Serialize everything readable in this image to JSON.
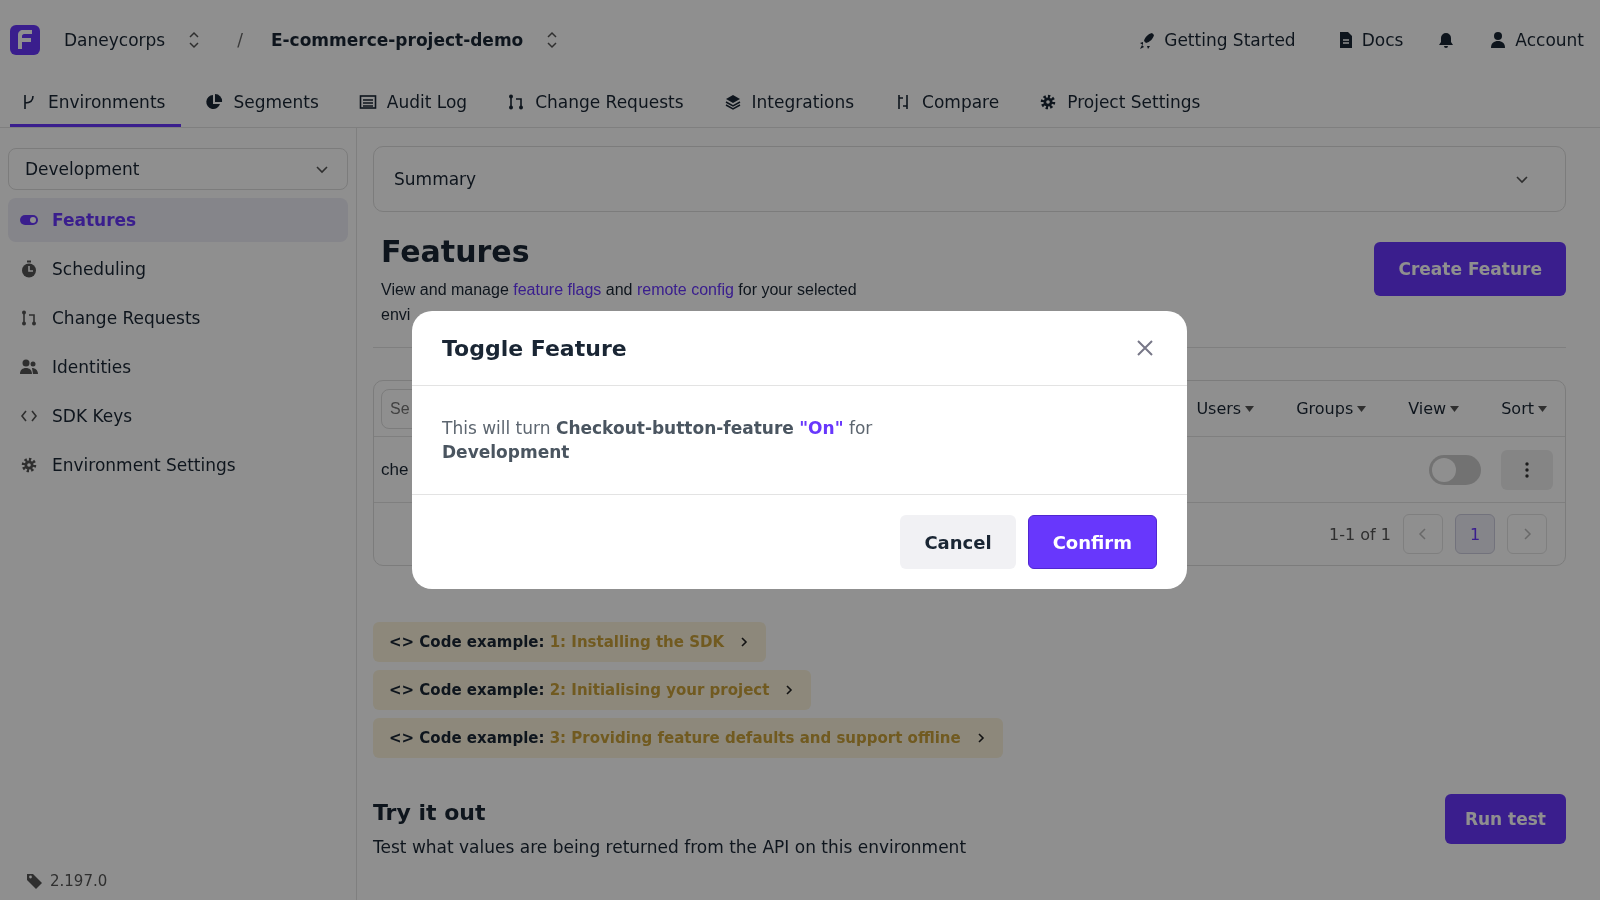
{
  "topbar": {
    "organisation": "Daneycorps",
    "separator": "/",
    "project": "E-commerce-project-demo",
    "links": [
      "Getting Started",
      "Docs",
      "Account"
    ]
  },
  "tabs": [
    {
      "label": "Environments",
      "selected": true
    },
    {
      "label": "Segments",
      "selected": false
    },
    {
      "label": "Audit Log",
      "selected": false
    },
    {
      "label": "Change Requests",
      "selected": false
    },
    {
      "label": "Integrations",
      "selected": false
    },
    {
      "label": "Compare",
      "selected": false
    },
    {
      "label": "Project Settings",
      "selected": false
    }
  ],
  "sidebar": {
    "environment": "Development",
    "items": [
      {
        "label": "Features",
        "selected": true
      },
      {
        "label": "Scheduling",
        "selected": false
      },
      {
        "label": "Change Requests",
        "selected": false
      },
      {
        "label": "Identities",
        "selected": false
      },
      {
        "label": "SDK Keys",
        "selected": false
      },
      {
        "label": "Environment Settings",
        "selected": false
      }
    ],
    "version": "2.197.0"
  },
  "summary": {
    "title": "Summary"
  },
  "features": {
    "title": "Features",
    "description": [
      {
        "text": "View and manage "
      },
      {
        "text": "feature flags",
        "link": true
      },
      {
        "text": " and "
      },
      {
        "text": "remote config",
        "link": true
      },
      {
        "text": " for your selected envi"
      }
    ],
    "create_button": "Create Feature",
    "search": {
      "placeholder": "Se"
    },
    "filters": [
      "Users",
      "Groups",
      "View",
      "Sort"
    ],
    "rows": [
      {
        "name": "che",
        "on": false
      }
    ],
    "pagination": {
      "range": "1-1 of 1",
      "pages": [
        {
          "label": "1",
          "selected": true
        }
      ]
    }
  },
  "code_examples": [
    {
      "prefix": "<> Code example: ",
      "title": "1: Installing the SDK"
    },
    {
      "prefix": "<> Code example: ",
      "title": "2: Initialising your project"
    },
    {
      "prefix": "<> Code example: ",
      "title": "3: Providing feature defaults and support offline"
    }
  ],
  "try_it": {
    "title": "Try it out",
    "text": "Test what values are being returned from the API on this environment",
    "button": "Run test"
  },
  "modal": {
    "title": "Toggle Feature",
    "message": "This will turn **Checkout-button-feature** ",
    "state": "\"On\"",
    "message_end": " for",
    "environment": "Development",
    "buttons": [
      {
        "kind": "secondary",
        "label": "Cancel"
      },
      {
        "kind": "primary",
        "label": "Confirm"
      }
    ]
  }
}
